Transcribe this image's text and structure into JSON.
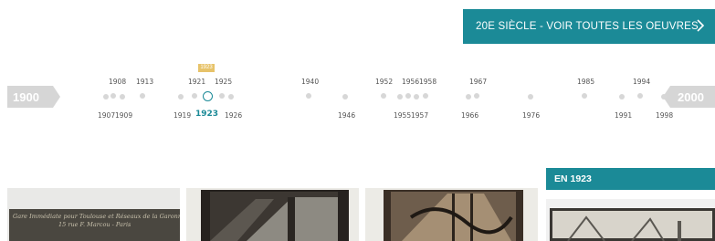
{
  "cta": {
    "label": "20E SIÈCLE - VOIR TOUTES LES OEUVRES",
    "color": "#1b8a97",
    "icon": "chevron-right-icon"
  },
  "timeline": {
    "start": "1900",
    "end": "2000",
    "hover_tag": "1923",
    "selected": "1923",
    "years_top": [
      "1908",
      "1913",
      "1921",
      "1925",
      "1940",
      "1952",
      "1956",
      "1958",
      "1967",
      "1985",
      "1994"
    ],
    "years_bottom": [
      "1907",
      "1909",
      "1919",
      "1926",
      "1946",
      "1955",
      "1957",
      "1966",
      "1976",
      "1991",
      "1998"
    ]
  },
  "section": {
    "heading": "EN 1923"
  },
  "cards": [
    {
      "caption_line1": "Gare Immédiate pour Toulouse et Réseaux de la Garonne",
      "caption_line2": "15 rue F. Marcou - Paris"
    },
    {
      "caption_line1": "",
      "caption_line2": ""
    },
    {
      "caption_line1": "",
      "caption_line2": ""
    },
    {
      "caption_line1": "",
      "caption_line2": ""
    }
  ]
}
